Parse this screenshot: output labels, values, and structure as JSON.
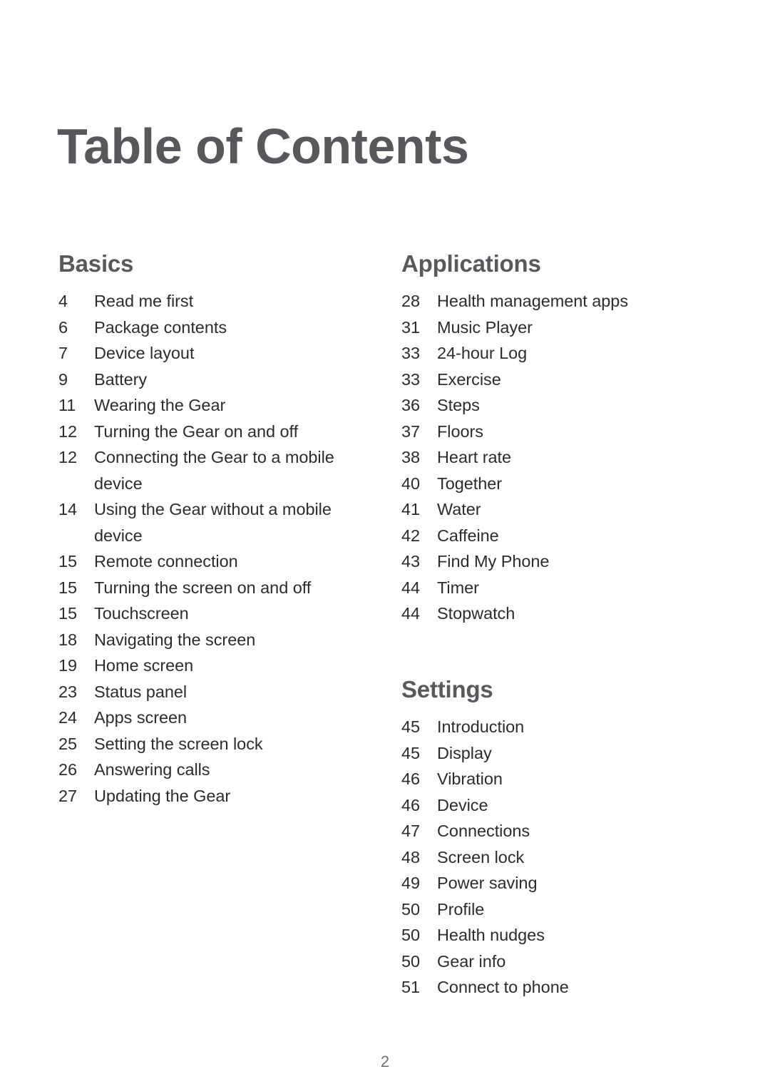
{
  "document": {
    "title": "Table of Contents",
    "page_number": "2",
    "colors": {
      "heading": "#58595d",
      "body_text": "#2c2c2c",
      "folio": "#6e7276",
      "background": "#ffffff"
    }
  },
  "columns": {
    "left": [
      {
        "heading": "Basics",
        "entries": [
          {
            "page": "4",
            "label": "Read me first"
          },
          {
            "page": "6",
            "label": "Package contents"
          },
          {
            "page": "7",
            "label": "Device layout"
          },
          {
            "page": "9",
            "label": "Battery"
          },
          {
            "page": "11",
            "label": "Wearing the Gear"
          },
          {
            "page": "12",
            "label": "Turning the Gear on and off"
          },
          {
            "page": "12",
            "label": "Connecting the Gear to a mobile device"
          },
          {
            "page": "14",
            "label": "Using the Gear without a mobile device"
          },
          {
            "page": "15",
            "label": "Remote connection"
          },
          {
            "page": "15",
            "label": "Turning the screen on and off"
          },
          {
            "page": "15",
            "label": "Touchscreen"
          },
          {
            "page": "18",
            "label": "Navigating the screen"
          },
          {
            "page": "19",
            "label": "Home screen"
          },
          {
            "page": "23",
            "label": "Status panel"
          },
          {
            "page": "24",
            "label": "Apps screen"
          },
          {
            "page": "25",
            "label": "Setting the screen lock"
          },
          {
            "page": "26",
            "label": "Answering calls"
          },
          {
            "page": "27",
            "label": "Updating the Gear"
          }
        ]
      }
    ],
    "right": [
      {
        "heading": "Applications",
        "entries": [
          {
            "page": "28",
            "label": "Health management apps"
          },
          {
            "page": "31",
            "label": "Music Player"
          },
          {
            "page": "33",
            "label": "24-hour Log"
          },
          {
            "page": "33",
            "label": "Exercise"
          },
          {
            "page": "36",
            "label": "Steps"
          },
          {
            "page": "37",
            "label": "Floors"
          },
          {
            "page": "38",
            "label": "Heart rate"
          },
          {
            "page": "40",
            "label": "Together"
          },
          {
            "page": "41",
            "label": "Water"
          },
          {
            "page": "42",
            "label": "Caffeine"
          },
          {
            "page": "43",
            "label": "Find My Phone"
          },
          {
            "page": "44",
            "label": "Timer"
          },
          {
            "page": "44",
            "label": "Stopwatch"
          }
        ]
      },
      {
        "heading": "Settings",
        "entries": [
          {
            "page": "45",
            "label": "Introduction"
          },
          {
            "page": "45",
            "label": "Display"
          },
          {
            "page": "46",
            "label": "Vibration"
          },
          {
            "page": "46",
            "label": "Device"
          },
          {
            "page": "47",
            "label": "Connections"
          },
          {
            "page": "48",
            "label": "Screen lock"
          },
          {
            "page": "49",
            "label": "Power saving"
          },
          {
            "page": "50",
            "label": "Profile"
          },
          {
            "page": "50",
            "label": "Health nudges"
          },
          {
            "page": "50",
            "label": "Gear info"
          },
          {
            "page": "51",
            "label": "Connect to phone"
          }
        ]
      }
    ]
  }
}
